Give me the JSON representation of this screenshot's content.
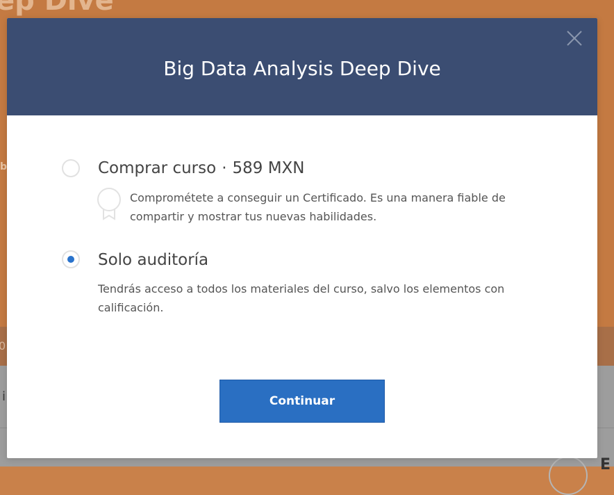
{
  "background": {
    "title_fragment": "ep Dive",
    "left_fragment": "b",
    "band_fragment": "0",
    "bottom_fragment": "i",
    "bottom_right_fragment": "E"
  },
  "modal": {
    "title": "Big Data Analysis Deep Dive",
    "close_icon": "close-icon",
    "options": [
      {
        "id": "buy",
        "label": "Comprar curso",
        "separator": "·",
        "price": "589 MXN",
        "selected": false,
        "icon": "certificate-icon",
        "description": "Comprométete a conseguir un Certificado. Es una manera fiable de compartir y mostrar tus nuevas habilidades."
      },
      {
        "id": "audit",
        "label": "Solo auditoría",
        "selected": true,
        "description": "Tendrás acceso a todos los materiales del curso, salvo los elementos con calificación."
      }
    ],
    "continue_label": "Continuar"
  },
  "colors": {
    "header": "#3b4d72",
    "accent": "#2a6fc2",
    "background_orange": "#c47a42"
  }
}
